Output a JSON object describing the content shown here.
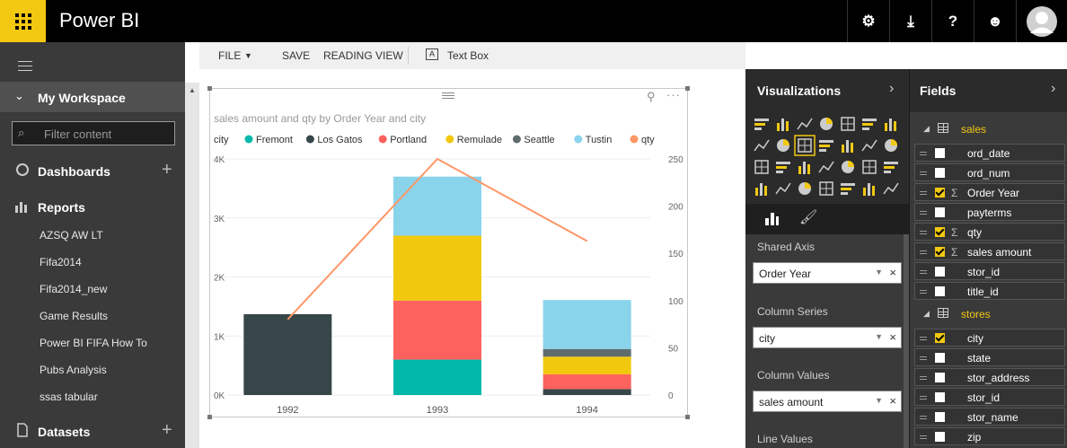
{
  "app": {
    "title": "Power BI"
  },
  "nav": {
    "workspace": "My Workspace",
    "filter_placeholder": "Filter content",
    "dashboards": "Dashboards",
    "reports": "Reports",
    "report_items": [
      "AZSQ AW LT",
      "Fifa2014",
      "Fifa2014_new",
      "Game Results",
      "Power BI FIFA How To",
      "Pubs Analysis",
      "ssas tabular"
    ],
    "datasets": "Datasets"
  },
  "toolbar": {
    "file": "FILE",
    "save": "SAVE",
    "reading_view": "READING VIEW",
    "text_box": "Text Box"
  },
  "viz": {
    "title": "Visualizations",
    "wells": [
      {
        "label": "Shared Axis",
        "value": "Order Year"
      },
      {
        "label": "Column Series",
        "value": "city"
      },
      {
        "label": "Column Values",
        "value": "sales amount"
      },
      {
        "label": "Line Values",
        "value": ""
      }
    ]
  },
  "fields": {
    "title": "Fields",
    "tables": [
      {
        "name": "sales",
        "items": [
          {
            "name": "ord_date",
            "checked": false,
            "sigma": false
          },
          {
            "name": "ord_num",
            "checked": false,
            "sigma": false
          },
          {
            "name": "Order Year",
            "checked": true,
            "sigma": true
          },
          {
            "name": "payterms",
            "checked": false,
            "sigma": false
          },
          {
            "name": "qty",
            "checked": true,
            "sigma": true
          },
          {
            "name": "sales amount",
            "checked": true,
            "sigma": true
          },
          {
            "name": "stor_id",
            "checked": false,
            "sigma": false
          },
          {
            "name": "title_id",
            "checked": false,
            "sigma": false
          }
        ]
      },
      {
        "name": "stores",
        "items": [
          {
            "name": "city",
            "checked": true,
            "sigma": false
          },
          {
            "name": "state",
            "checked": false,
            "sigma": false
          },
          {
            "name": "stor_address",
            "checked": false,
            "sigma": false
          },
          {
            "name": "stor_id",
            "checked": false,
            "sigma": false
          },
          {
            "name": "stor_name",
            "checked": false,
            "sigma": false
          },
          {
            "name": "zip",
            "checked": false,
            "sigma": false
          }
        ]
      }
    ]
  },
  "chart_data": {
    "type": "bar",
    "title": "sales amount and qty by Order Year and city",
    "legend_title": "city",
    "legend_position": "top-left",
    "categories": [
      "1992",
      "1993",
      "1994"
    ],
    "series": [
      {
        "name": "Fremont",
        "color": "#01b8aa",
        "values": [
          0,
          600,
          0
        ]
      },
      {
        "name": "Los Gatos",
        "color": "#374649",
        "values": [
          1370,
          0,
          100
        ]
      },
      {
        "name": "Portland",
        "color": "#fd625e",
        "values": [
          0,
          1000,
          250
        ]
      },
      {
        "name": "Remulade",
        "color": "#f2c80f",
        "values": [
          0,
          1100,
          300
        ]
      },
      {
        "name": "Seattle",
        "color": "#5f6b6d",
        "values": [
          0,
          0,
          130
        ]
      },
      {
        "name": "Tustin",
        "color": "#8ad4eb",
        "values": [
          0,
          1000,
          830
        ]
      }
    ],
    "line": {
      "name": "qty",
      "color": "#fe9666",
      "values": [
        80,
        250,
        163
      ]
    },
    "y_left": {
      "ticks": [
        "0K",
        "1K",
        "2K",
        "3K",
        "4K"
      ],
      "range": [
        0,
        4000
      ]
    },
    "y_right": {
      "ticks": [
        "0",
        "50",
        "100",
        "150",
        "200",
        "250"
      ],
      "range": [
        0,
        250
      ]
    }
  }
}
